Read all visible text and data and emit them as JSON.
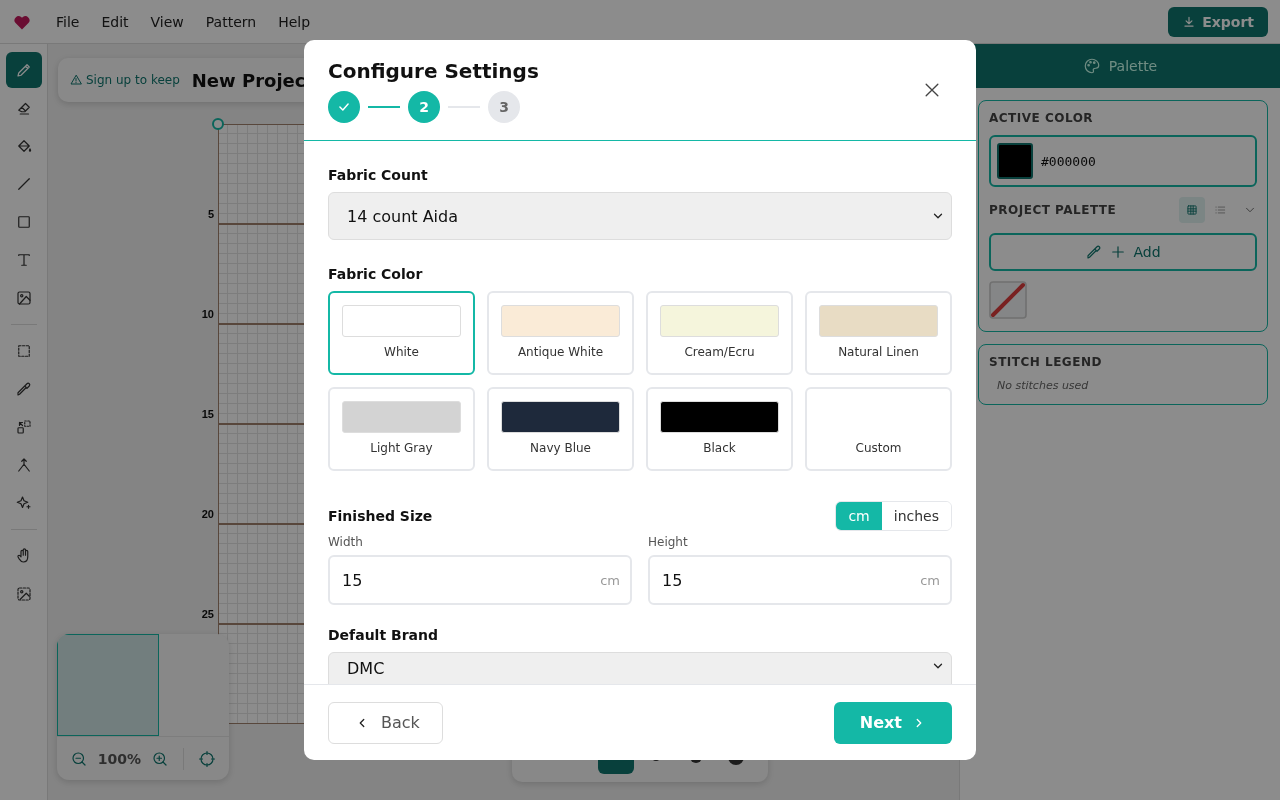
{
  "menu": [
    "File",
    "Edit",
    "View",
    "Pattern",
    "Help"
  ],
  "export_button": "Export",
  "tool_groups": [
    [
      {
        "kind": "pencil",
        "selected": true
      },
      {
        "kind": "eraser",
        "selected": false
      },
      {
        "kind": "fill",
        "selected": false
      },
      {
        "kind": "line",
        "selected": false
      },
      {
        "kind": "rect",
        "selected": false
      },
      {
        "kind": "text",
        "selected": false
      },
      {
        "kind": "image",
        "selected": false
      }
    ],
    [
      {
        "kind": "select",
        "selected": false
      },
      {
        "kind": "eyedropper",
        "selected": false
      },
      {
        "kind": "move",
        "selected": false
      },
      {
        "kind": "merge",
        "selected": false
      },
      {
        "kind": "sparkle",
        "selected": false
      }
    ],
    [
      {
        "kind": "hand",
        "selected": false
      },
      {
        "kind": "trace",
        "selected": false
      }
    ]
  ],
  "canvas": {
    "banner": "Sign up to keep",
    "project_title": "New Projec",
    "row_labels": [
      "5",
      "10",
      "15",
      "20",
      "25"
    ]
  },
  "navigator": {
    "zoom": "100%"
  },
  "brush_sizes": [
    {
      "selected": true
    },
    {
      "selected": false
    },
    {
      "selected": false
    },
    {
      "selected": false
    }
  ],
  "palette_panel": {
    "tab": "Palette",
    "active_color_label": "ACTIVE COLOR",
    "active_color": {
      "hex": "#000000",
      "color": "#000000"
    },
    "project_palette_label": "PROJECT PALETTE",
    "view_modes": [
      {
        "kind": "grid",
        "selected": true
      },
      {
        "kind": "list",
        "selected": false
      }
    ],
    "add_button": "Add",
    "legend_label": "STITCH LEGEND",
    "legend_empty": "No stitches used"
  },
  "dialog": {
    "title": "Configure Settings",
    "steps": [
      {
        "done": true
      },
      {
        "label": "2",
        "done": false,
        "current": true
      },
      {
        "label": "3",
        "done": false,
        "current": false
      }
    ],
    "fabric_count": {
      "label": "Fabric Count",
      "value": "14 count Aida"
    },
    "fabric_color": {
      "label": "Fabric Color",
      "options": [
        {
          "name": "White",
          "kind": "swatch",
          "color": "#ffffff",
          "selected": true
        },
        {
          "name": "Antique White",
          "kind": "swatch",
          "color": "#faebd7",
          "selected": false
        },
        {
          "name": "Cream/Ecru",
          "kind": "swatch",
          "color": "#f5f5dc",
          "selected": false
        },
        {
          "name": "Natural Linen",
          "kind": "swatch",
          "color": "#e8dcc4",
          "selected": false
        },
        {
          "name": "Light Gray",
          "kind": "swatch",
          "color": "#d3d3d3",
          "selected": false
        },
        {
          "name": "Navy Blue",
          "kind": "swatch",
          "color": "#1e293b",
          "selected": false
        },
        {
          "name": "Black",
          "kind": "swatch",
          "color": "#000000",
          "selected": false
        },
        {
          "name": "Custom",
          "kind": "custom",
          "selected": false
        }
      ]
    },
    "finished_size": {
      "label": "Finished Size",
      "units": [
        {
          "label": "cm",
          "selected": true
        },
        {
          "label": "inches",
          "selected": false
        }
      ],
      "width": {
        "label": "Width",
        "value": "15",
        "unit": "cm"
      },
      "height": {
        "label": "Height",
        "value": "15",
        "unit": "cm"
      }
    },
    "default_brand": {
      "label": "Default Brand",
      "value": "DMC"
    },
    "back_button": "Back",
    "next_button": "Next"
  }
}
